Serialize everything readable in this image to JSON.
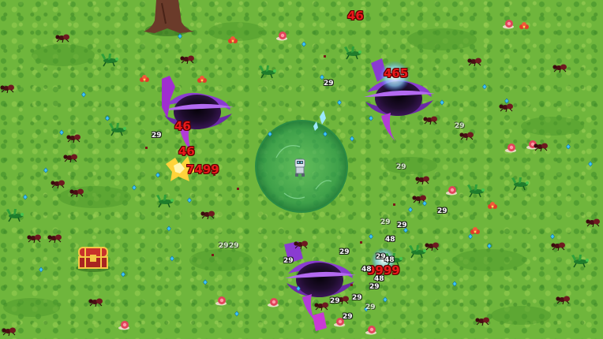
{
  "colors": {
    "grass": "#6fb63c",
    "aura": "#3da35a",
    "vortex_purple": "#8a3bd1",
    "vortex_core": "#1a0b24",
    "damage_crit": "#e8191b",
    "damage_normal": "#ffffff",
    "xp_gem": "#3ec8ff",
    "chest_red": "#c8322a",
    "chest_gold": "#f3c845"
  },
  "icons": [
    "player-robot-icon",
    "aura-field",
    "black-hole-vortex-icon",
    "treasure-chest-icon",
    "tree-icon",
    "ant-enemy-icon",
    "mantis-enemy-icon",
    "snail-enemy-icon",
    "xp-gem-icon",
    "red-flower-icon"
  ],
  "damage_numbers": [
    {
      "text": "46"
    },
    {
      "text": "465"
    },
    {
      "text": "46"
    },
    {
      "text": "46"
    },
    {
      "text": "7499"
    },
    {
      "text": "9999"
    },
    {
      "text": "29"
    },
    {
      "text": "29"
    },
    {
      "text": "29"
    },
    {
      "text": "29"
    },
    {
      "text": "29"
    },
    {
      "text": "29"
    },
    {
      "text": "29"
    },
    {
      "text": "29"
    },
    {
      "text": "29"
    },
    {
      "text": "29"
    },
    {
      "text": "29"
    },
    {
      "text": "48"
    },
    {
      "text": "48"
    },
    {
      "text": "48"
    },
    {
      "text": "48"
    },
    {
      "text": "29"
    },
    {
      "text": "29"
    },
    {
      "text": "29"
    },
    {
      "text": "29"
    },
    {
      "text": "29"
    },
    {
      "text": "29"
    }
  ]
}
